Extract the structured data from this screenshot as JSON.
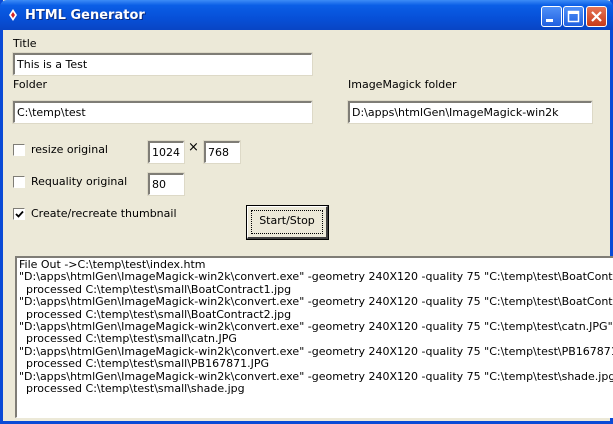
{
  "window": {
    "title": "HTML Generator"
  },
  "form": {
    "title_label": "Title",
    "title_value": "This is a Test",
    "folder_label": "Folder",
    "folder_value": "C:\\temp\\test",
    "imagemagick_label": "ImageMagick folder",
    "imagemagick_value": "D:\\apps\\htmlGen\\ImageMagick-win2k",
    "resize_label": "resize original",
    "resize_checked": false,
    "resize_width": "1024",
    "times_symbol": "×",
    "resize_height": "768",
    "requality_label": "Requality original",
    "requality_checked": false,
    "quality_value": "80",
    "thumbnail_label": "Create/recreate thumbnail",
    "thumbnail_checked": true,
    "start_stop_label": "Start/Stop"
  },
  "log": {
    "lines": [
      "File Out ->C:\\temp\\test\\index.htm",
      "\"D:\\apps\\htmlGen\\ImageMagick-win2k\\convert.exe\" -geometry 240X120 -quality 75 \"C:\\temp\\test\\BoatContract1.jpg\" \"C:\\te",
      "  processed C:\\temp\\test\\small\\BoatContract1.jpg",
      "\"D:\\apps\\htmlGen\\ImageMagick-win2k\\convert.exe\" -geometry 240X120 -quality 75 \"C:\\temp\\test\\BoatContract2.jpg\" \"C:\\te",
      "  processed C:\\temp\\test\\small\\BoatContract2.jpg",
      "\"D:\\apps\\htmlGen\\ImageMagick-win2k\\convert.exe\" -geometry 240X120 -quality 75 \"C:\\temp\\test\\catn.JPG\" \"C:\\temp\\test\\",
      "  processed C:\\temp\\test\\small\\catn.JPG",
      "\"D:\\apps\\htmlGen\\ImageMagick-win2k\\convert.exe\" -geometry 240X120 -quality 75 \"C:\\temp\\test\\PB167871.JPG\" \"C:\\temp",
      "  processed C:\\temp\\test\\small\\PB167871.JPG",
      "\"D:\\apps\\htmlGen\\ImageMagick-win2k\\convert.exe\" -geometry 240X120 -quality 75 \"C:\\temp\\test\\shade.jpg\" \"C:\\temp\\test\\",
      "  processed C:\\temp\\test\\small\\shade.jpg"
    ]
  },
  "colors": {
    "titlebar": "#0750d8",
    "window_bg": "#ece9d8",
    "close_button": "#c73a19"
  }
}
